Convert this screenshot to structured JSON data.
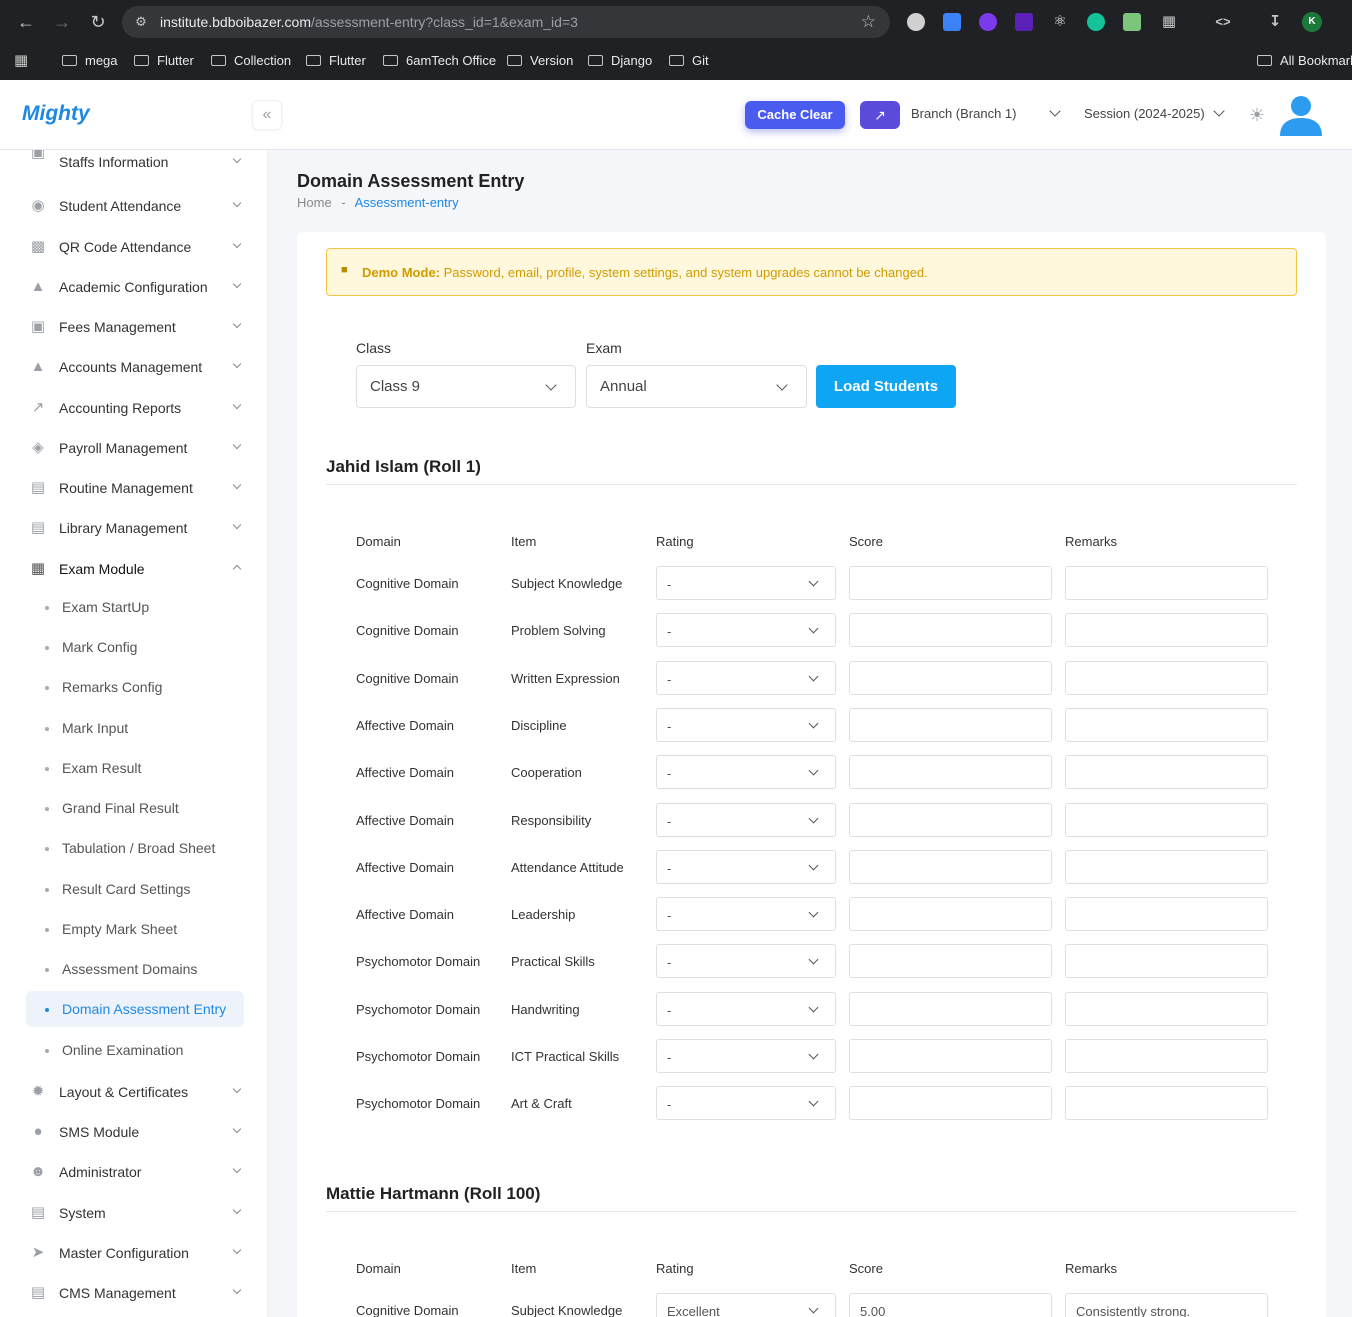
{
  "browser": {
    "url_host": "institute.bdboibazer.com",
    "url_path": "/assessment-entry?class_id=1&exam_id=3",
    "bookmarks": [
      "mega",
      "Flutter",
      "Collection",
      "Flutter",
      "6amTech Office",
      "Version",
      "Django",
      "Git"
    ],
    "all_bookmarks": "All Bookmarks",
    "profile_initial": "K"
  },
  "header": {
    "logo": "Mighty",
    "cache_clear": "Cache Clear",
    "branch": "Branch (Branch 1)",
    "session": "Session (2024-2025)"
  },
  "sidebar": {
    "top_partial": "Staffs Information",
    "items": [
      {
        "label": "Student Attendance",
        "icon": "fingerprint-icon"
      },
      {
        "label": "QR Code Attendance",
        "icon": "qr-code-icon"
      },
      {
        "label": "Academic Configuration",
        "icon": "gear-icon"
      },
      {
        "label": "Fees Management",
        "icon": "money-icon"
      },
      {
        "label": "Accounts Management",
        "icon": "bank-icon"
      },
      {
        "label": "Accounting Reports",
        "icon": "line-chart-icon"
      },
      {
        "label": "Payroll Management",
        "icon": "hand-money-icon"
      },
      {
        "label": "Routine Management",
        "icon": "map-icon"
      },
      {
        "label": "Library Management",
        "icon": "book-icon"
      },
      {
        "label": "Exam Module",
        "icon": "layout-icon"
      }
    ],
    "exam_sub": [
      "Exam StartUp",
      "Mark Config",
      "Remarks Config",
      "Mark Input",
      "Exam Result",
      "Grand Final Result",
      "Tabulation / Broad Sheet",
      "Result Card Settings",
      "Empty Mark Sheet",
      "Assessment Domains",
      "Domain Assessment Entry",
      "Online Examination"
    ],
    "bottom_items": [
      {
        "label": "Layout & Certificates",
        "icon": "badge-icon"
      },
      {
        "label": "SMS Module",
        "icon": "sms-icon"
      },
      {
        "label": "Administrator",
        "icon": "user-shield-icon"
      },
      {
        "label": "System",
        "icon": "server-icon"
      },
      {
        "label": "Master Configuration",
        "icon": "rocket-icon"
      },
      {
        "label": "CMS Management",
        "icon": "map-icon"
      }
    ]
  },
  "page": {
    "title": "Domain Assessment Entry",
    "breadcrumb_home": "Home",
    "breadcrumb_sep": "-",
    "breadcrumb_current": "Assessment-entry",
    "demo_label": "Demo Mode:",
    "demo_text": "Password, email, profile, system settings, and system upgrades cannot be changed.",
    "filters": {
      "class_label": "Class",
      "class_value": "Class 9",
      "exam_label": "Exam",
      "exam_value": "Annual",
      "load_button": "Load Students"
    },
    "columns": {
      "domain": "Domain",
      "item": "Item",
      "rating": "Rating",
      "score": "Score",
      "remarks": "Remarks"
    },
    "students": [
      {
        "name": "Jahid Islam (Roll 1)",
        "rows": [
          {
            "domain": "Cognitive Domain",
            "item": "Subject Knowledge",
            "rating": "-",
            "score": "",
            "remarks": ""
          },
          {
            "domain": "Cognitive Domain",
            "item": "Problem Solving",
            "rating": "-",
            "score": "",
            "remarks": ""
          },
          {
            "domain": "Cognitive Domain",
            "item": "Written Expression",
            "rating": "-",
            "score": "",
            "remarks": ""
          },
          {
            "domain": "Affective Domain",
            "item": "Discipline",
            "rating": "-",
            "score": "",
            "remarks": ""
          },
          {
            "domain": "Affective Domain",
            "item": "Cooperation",
            "rating": "-",
            "score": "",
            "remarks": ""
          },
          {
            "domain": "Affective Domain",
            "item": "Responsibility",
            "rating": "-",
            "score": "",
            "remarks": ""
          },
          {
            "domain": "Affective Domain",
            "item": "Attendance Attitude",
            "rating": "-",
            "score": "",
            "remarks": ""
          },
          {
            "domain": "Affective Domain",
            "item": "Leadership",
            "rating": "-",
            "score": "",
            "remarks": ""
          },
          {
            "domain": "Psychomotor Domain",
            "item": "Practical Skills",
            "rating": "-",
            "score": "",
            "remarks": ""
          },
          {
            "domain": "Psychomotor Domain",
            "item": "Handwriting",
            "rating": "-",
            "score": "",
            "remarks": ""
          },
          {
            "domain": "Psychomotor Domain",
            "item": "ICT Practical Skills",
            "rating": "-",
            "score": "",
            "remarks": ""
          },
          {
            "domain": "Psychomotor Domain",
            "item": "Art & Craft",
            "rating": "-",
            "score": "",
            "remarks": ""
          }
        ]
      },
      {
        "name": "Mattie Hartmann (Roll 100)",
        "rows": [
          {
            "domain": "Cognitive Domain",
            "item": "Subject Knowledge",
            "rating": "Excellent",
            "score": "5.00",
            "remarks": "Consistently strong."
          }
        ]
      }
    ]
  }
}
